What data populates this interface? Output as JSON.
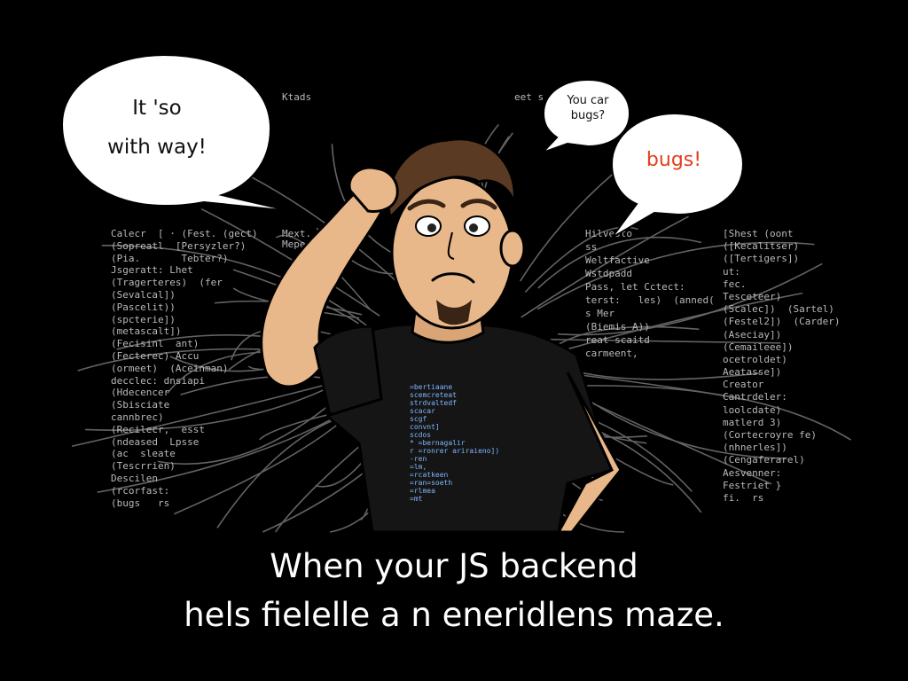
{
  "bubbles": {
    "left_line1": "It 'so",
    "left_line2": "with way!",
    "top_right_line1": "You car",
    "top_right_line2": "bugs?",
    "right": "bugs!"
  },
  "caption": {
    "line1": "When your JS backend",
    "line2": "hels  fielelle  a  n  eneridlens  maze."
  },
  "colors": {
    "background": "#000000",
    "caption": "#ffffff",
    "bubble": "#ffffff",
    "bug_text": "#e0401f",
    "shirt": "#151515",
    "skin": "#e9b88a",
    "hair": "#5a3a22"
  },
  "code_snippets": {
    "left": [
      "Calecr  [ · (Fest. (gect)",
      "(Sopreatl  [Persyzler?)",
      "(Pia.       Tebter?)",
      "Jsgeratt: Lhet",
      "(Tragerteres)  (fer",
      "(Sevalcal])",
      "(Pascelit))",
      "(spcterie])",
      "(metascalt])",
      "(Fecisinl  ant)",
      "(Fecterec) Accu",
      "(ormeet)  (Aceinman)",
      "decclec: dnsiapi",
      "(Hdecencer",
      "(Sbisciate",
      "cannbrec)",
      "(Recilecr,  esst",
      "(ndeased  Lpsse",
      "(ac  sleate",
      "(Tescrrien)",
      "Descilen",
      "(rcorfast:",
      "(bugs   rs"
    ],
    "top": "Ktads",
    "top2": "eet s",
    "mid_left": "Mext. (er\nMeperlr",
    "right": [
      "[Shest (oont",
      "([Kecalitser)",
      "([Tertigers])",
      "ut:",
      "fec.",
      "Tesceteer)",
      "(Scalec])  (Sartel)",
      "(Festel2])  (Carder)",
      "(Aseciay])",
      "(Cemaileee])",
      "ocetroldet)",
      "Aeatasse])",
      "Creator",
      "Cantrdeler:",
      "loolcdate)",
      "matlerd 3)",
      "(Cortecroyre fe)",
      "(nhnerles])",
      "(Cengaferarel)",
      "Aesvenner:",
      "Festriet }",
      "fi.  rs"
    ],
    "mid_right": [
      "Hilvesto",
      "ss",
      "Weltfactive",
      "Wstdpadd",
      "Pass, let Cctect:",
      "terst:   les)  (anned(",
      "s Mer",
      "(Biemis A))",
      "reat scaitd",
      "carmeent,"
    ],
    "shirt": [
      "=bertiaane",
      "scemcreteat",
      "strdvaltedf",
      "scacar",
      "scgf",
      "convnt]",
      "scdos",
      "* =bernagalir",
      "r =ronrer ariraieno])",
      "-ren",
      "=lm,",
      "=rcatkeen",
      "=ran=soeth",
      "=rlmea",
      "=mt"
    ]
  }
}
